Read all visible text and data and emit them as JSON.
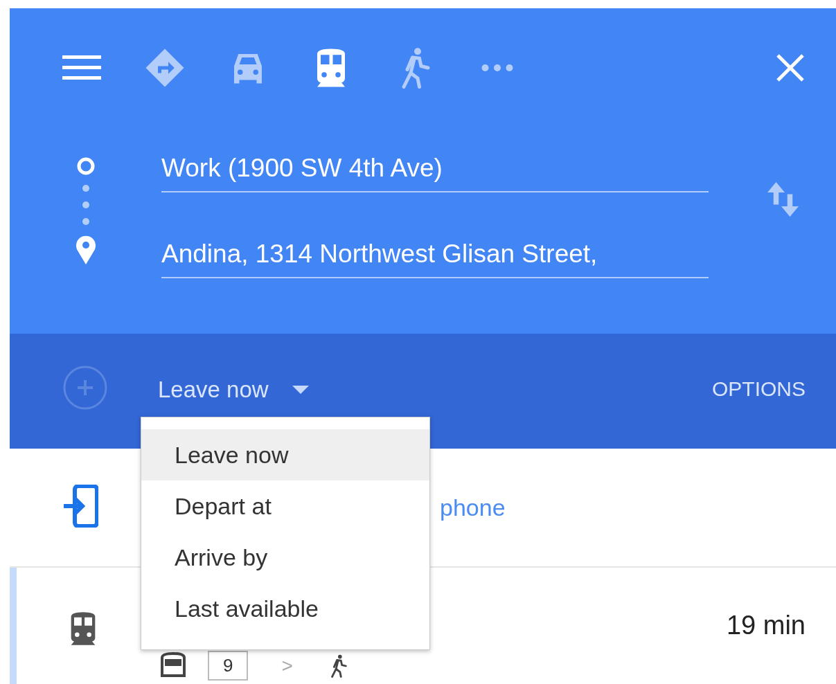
{
  "travel_modes": [
    {
      "kind": "best",
      "selected": false
    },
    {
      "kind": "car",
      "selected": false
    },
    {
      "kind": "transit",
      "selected": true
    },
    {
      "kind": "walk",
      "selected": false
    },
    {
      "kind": "more",
      "selected": false
    }
  ],
  "origin": {
    "value": "Work (1900 SW 4th Ave)"
  },
  "destination": {
    "value": "Andina, 1314 Northwest Glisan Street,"
  },
  "time_selector": {
    "label": "Leave now"
  },
  "options_label": "OPTIONS",
  "time_menu": [
    {
      "label": "Leave now",
      "selected": true
    },
    {
      "label": "Depart at",
      "selected": false
    },
    {
      "label": "Arrive by",
      "selected": false
    },
    {
      "label": "Last available",
      "selected": false
    }
  ],
  "send_to_phone": {
    "label": "phone"
  },
  "routes": [
    {
      "selected": true,
      "duration": "19 min",
      "steps": [
        {
          "kind": "bus"
        },
        {
          "kind": "line",
          "label": "9"
        },
        {
          "kind": "separator",
          "label": ">"
        },
        {
          "kind": "walk"
        }
      ]
    }
  ]
}
